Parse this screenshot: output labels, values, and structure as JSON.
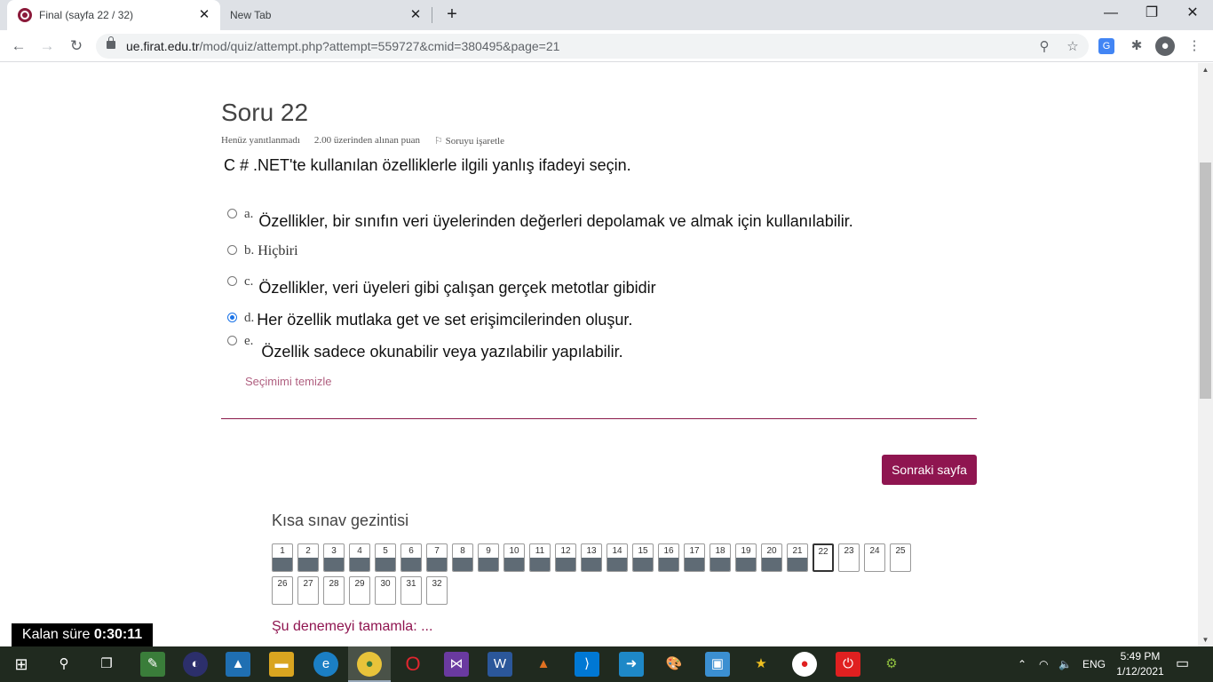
{
  "browser": {
    "tabs": [
      {
        "title": "Final (sayfa 22 / 32)"
      },
      {
        "title": "New Tab"
      }
    ],
    "url_domain": "ue.firat.edu.tr",
    "url_path": "/mod/quiz/attempt.php?attempt=559727&cmid=380495&page=21"
  },
  "question": {
    "title": "Soru 22",
    "status": "Henüz yanıtlanmadı",
    "points": "2.00 üzerinden alınan puan",
    "flag_label": "Soruyu işaretle",
    "text": "C # .NET'te kullanılan özelliklerle ilgili yanlış ifadeyi seçin.",
    "options": [
      {
        "letter": "a.",
        "text": "Özellikler, bir sınıfın veri üyelerinden değerleri depolamak ve almak için kullanılabilir.",
        "checked": false
      },
      {
        "letter": "b.",
        "text": "Hiçbiri",
        "checked": false
      },
      {
        "letter": "c.",
        "text": "Özellikler, veri üyeleri gibi çalışan gerçek metotlar gibidir",
        "checked": false
      },
      {
        "letter": "d.",
        "text": "Her özellik mutlaka get ve set erişimcilerinden oluşur.",
        "checked": true
      },
      {
        "letter": "e.",
        "text": "Özellik sadece okunabilir veya yazılabilir yapılabilir.",
        "checked": false
      }
    ],
    "clear_label": "Seçimimi temizle"
  },
  "next_button": "Sonraki sayfa",
  "quiz_nav": {
    "title": "Kısa sınav gezintisi",
    "buttons": [
      "1",
      "2",
      "3",
      "4",
      "5",
      "6",
      "7",
      "8",
      "9",
      "10",
      "11",
      "12",
      "13",
      "14",
      "15",
      "16",
      "17",
      "18",
      "19",
      "20",
      "21",
      "22",
      "23",
      "24",
      "25",
      "26",
      "27",
      "28",
      "29",
      "30",
      "31",
      "32"
    ],
    "answered_count": 21,
    "current": "22",
    "finish_label": "Şu denemeyi tamamla: ..."
  },
  "timer": {
    "label": "Kalan süre",
    "value": "0:30:11"
  },
  "taskbar": {
    "language": "ENG",
    "time": "5:49 PM",
    "date": "1/12/2021"
  }
}
